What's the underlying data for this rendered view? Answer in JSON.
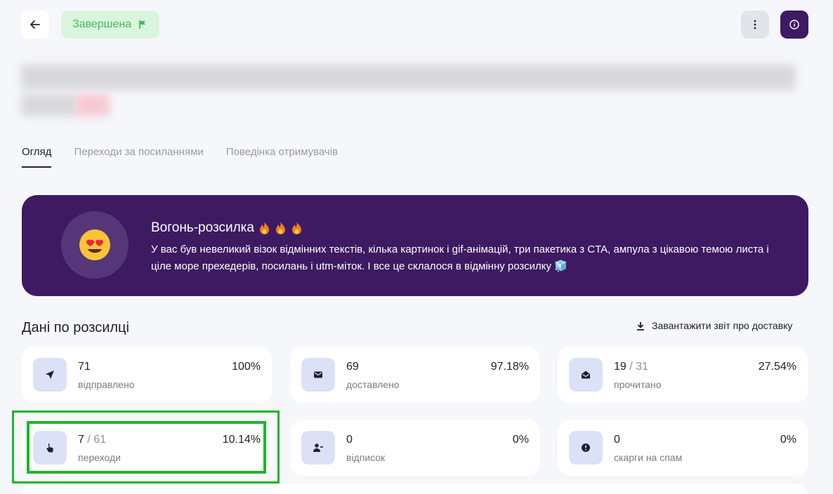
{
  "header": {
    "status_label": "Завершена"
  },
  "tabs": [
    {
      "label": "Огляд",
      "active": true
    },
    {
      "label": "Переходи за посиланнями",
      "active": false
    },
    {
      "label": "Поведінка отримувачів",
      "active": false
    }
  ],
  "banner": {
    "title": "Вогонь-розсилка",
    "text": "У вас був невеликий візок відмінних текстів, кілька картинок і gif-анімацій, три пакетика з CTA, ампула з цікавою темою листа і ціле море прехедерів, посилань і utm-міток. І все це склалося в відмінну розсилку 🧊"
  },
  "stats_section": {
    "title": "Дані по розсилці",
    "download_label": "Завантажити звіт про доставку"
  },
  "stats": [
    {
      "value": "71",
      "total": "",
      "label": "відправлено",
      "percent": "100%",
      "icon": "send-icon"
    },
    {
      "value": "69",
      "total": "",
      "label": "доставлено",
      "percent": "97.18%",
      "icon": "envelope-icon"
    },
    {
      "value": "19",
      "total": " / 31",
      "label": "прочитано",
      "percent": "27.54%",
      "icon": "open-envelope-icon"
    },
    {
      "value": "7",
      "total": " / 61",
      "label": "переходи",
      "percent": "10.14%",
      "icon": "pointer-hand-icon"
    },
    {
      "value": "0",
      "total": "",
      "label": "відписок",
      "percent": "0%",
      "icon": "user-minus-icon"
    },
    {
      "value": "0",
      "total": "",
      "label": "скарги на спам",
      "percent": "0%",
      "icon": "alert-icon"
    }
  ],
  "colors": {
    "brand_purple": "#3d1a62",
    "success_green": "#49b95a",
    "highlight_green": "#1fb52a",
    "icon_bg": "#dbe2f8"
  }
}
